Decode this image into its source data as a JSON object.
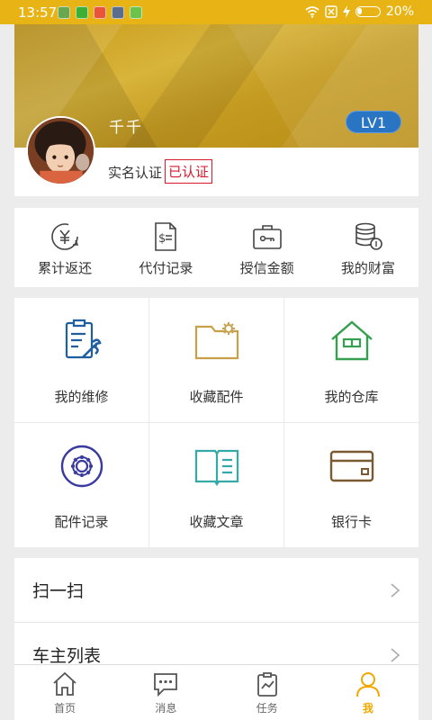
{
  "status_bar": {
    "time": "13:57",
    "battery": "20%",
    "battery_level": 0.2
  },
  "profile": {
    "name": "千千",
    "level": "LV1",
    "realname_label": "实名认证",
    "verified_label": "已认证"
  },
  "stats": [
    {
      "label": "累计返还",
      "icon": "yen-return-icon"
    },
    {
      "label": "代付记录",
      "icon": "bill-icon"
    },
    {
      "label": "授信金额",
      "icon": "briefcase-key-icon"
    },
    {
      "label": "我的财富",
      "icon": "coins-stack-icon"
    }
  ],
  "grid": [
    {
      "label": "我的维修",
      "icon": "repair-clipboard-icon"
    },
    {
      "label": "收藏配件",
      "icon": "folder-gear-icon"
    },
    {
      "label": "我的仓库",
      "icon": "warehouse-icon"
    },
    {
      "label": "配件记录",
      "icon": "gear-circle-icon"
    },
    {
      "label": "收藏文章",
      "icon": "open-book-icon"
    },
    {
      "label": "银行卡",
      "icon": "bank-card-icon"
    }
  ],
  "list": [
    {
      "label": "扫一扫"
    },
    {
      "label": "车主列表"
    }
  ],
  "tabs": [
    {
      "label": "首页",
      "icon": "home-icon"
    },
    {
      "label": "消息",
      "icon": "message-icon"
    },
    {
      "label": "任务",
      "icon": "task-icon"
    },
    {
      "label": "我",
      "icon": "user-icon",
      "active": true
    }
  ],
  "colors": {
    "accent": "#f0a800",
    "status_bar": "#e8b415",
    "badge": "#2a74c4",
    "verified": "#d8192b"
  }
}
